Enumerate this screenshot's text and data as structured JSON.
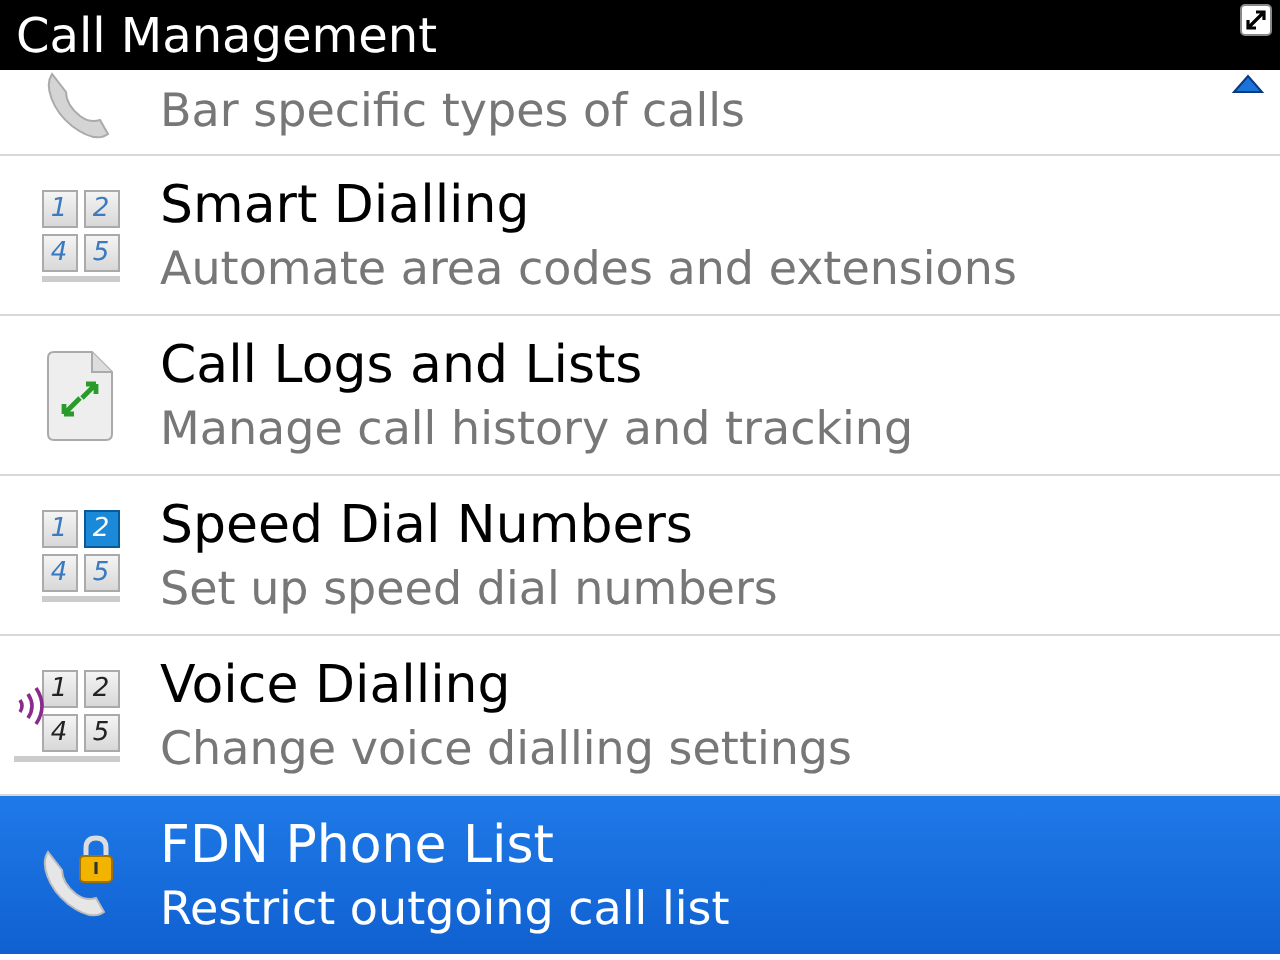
{
  "window": {
    "title": "Call Management"
  },
  "items": [
    {
      "kind": "barring",
      "description": "Bar specific types of calls",
      "selected": false,
      "partial": true
    },
    {
      "kind": "keypad",
      "title": "Smart Dialling",
      "description": "Automate area codes and extensions",
      "selected": false,
      "keys": [
        {
          "label": "1",
          "selected": false
        },
        {
          "label": "2",
          "selected": false
        },
        {
          "label": "4",
          "selected": false
        },
        {
          "label": "5",
          "selected": false
        }
      ]
    },
    {
      "kind": "log",
      "title": "Call Logs and Lists",
      "description": "Manage call history and tracking",
      "selected": false
    },
    {
      "kind": "keypad",
      "title": "Speed Dial Numbers",
      "description": "Set up speed dial numbers",
      "selected": false,
      "keys": [
        {
          "label": "1",
          "selected": false
        },
        {
          "label": "2",
          "selected": true
        },
        {
          "label": "4",
          "selected": false
        },
        {
          "label": "5",
          "selected": false
        }
      ]
    },
    {
      "kind": "voice",
      "title": "Voice Dialling",
      "description": "Change voice dialling settings",
      "selected": false,
      "keys": [
        {
          "label": "1",
          "selected": false
        },
        {
          "label": "2",
          "selected": false
        },
        {
          "label": "4",
          "selected": false
        },
        {
          "label": "5",
          "selected": false
        }
      ]
    },
    {
      "kind": "lock",
      "title": "FDN Phone List",
      "description": "Restrict outgoing call list",
      "selected": true
    }
  ]
}
